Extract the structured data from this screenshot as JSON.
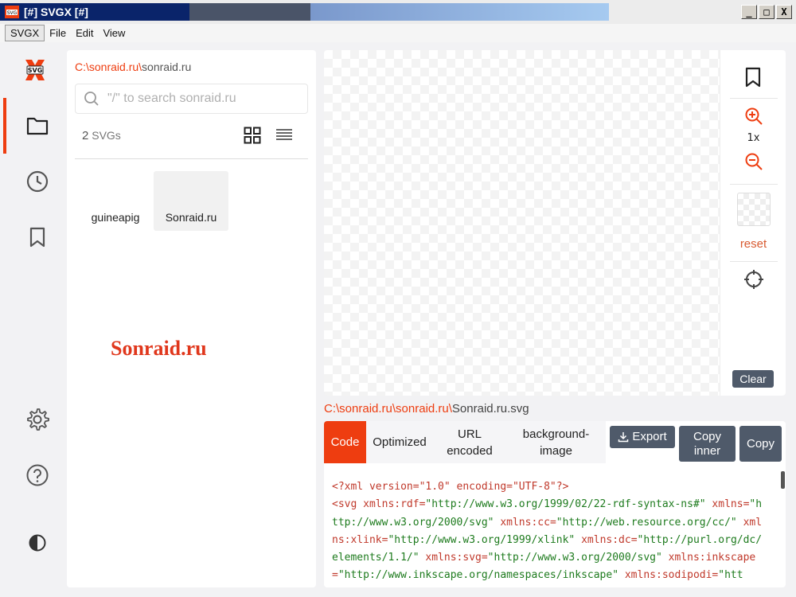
{
  "window": {
    "title": "[#] SVGX [#]",
    "icon_text": "SVG",
    "controls": [
      "_",
      "□",
      "X"
    ]
  },
  "menu": [
    "SVGX",
    "File",
    "Edit",
    "View"
  ],
  "colors": {
    "accent": "#ee3d10",
    "button": "#4f5a6a"
  },
  "rail": {
    "items": [
      {
        "name": "folder-icon",
        "active": true
      },
      {
        "name": "history-icon",
        "active": false
      },
      {
        "name": "bookmark-icon",
        "active": false
      },
      {
        "name": "settings-icon",
        "active": false
      },
      {
        "name": "help-icon",
        "active": false
      },
      {
        "name": "contrast-icon",
        "active": false
      }
    ]
  },
  "files": {
    "breadcrumb": {
      "root": "C:\\",
      "folder": "sonraid.ru",
      "sep": "\\",
      "current": "sonraid.ru"
    },
    "search_placeholder": "\"/\" to search sonraid.ru",
    "count_num": "2",
    "count_label": " SVGs",
    "items": [
      {
        "label": "guineapig",
        "selected": false
      },
      {
        "label": "Sonraid.ru",
        "selected": true
      }
    ],
    "watermark": "Sonraid.ru"
  },
  "preview": {
    "zoom": "1x",
    "reset": "reset",
    "clear": "Clear"
  },
  "file_path": {
    "root": "C:\\",
    "seg1": "sonraid.ru",
    "seg2": "sonraid.ru",
    "sep": "\\",
    "file": "Sonraid.ru.svg"
  },
  "code_panel": {
    "tabs": [
      {
        "label": "Code",
        "active": true
      },
      {
        "label": "Optimized",
        "active": false
      },
      {
        "label": "URL\nencoded",
        "active": false
      },
      {
        "label": "background-\nimage",
        "active": false
      }
    ],
    "export": "Export",
    "copy_inner": "Copy\ninner",
    "copy": "Copy",
    "lines": [
      [
        [
          "t",
          "<?xml version=\"1.0\" encoding=\"UTF-8\"?>"
        ]
      ],
      [
        [
          "t",
          "<svg xmlns:rdf="
        ],
        [
          "v",
          "\"http://www.w3.org/1999/02/22-rdf-syntax-ns#\""
        ],
        [
          "t",
          " xmlns="
        ],
        [
          "v",
          "\"h"
        ]
      ],
      [
        [
          "v",
          "ttp://www.w3.org/2000/svg\""
        ],
        [
          "t",
          " xmlns:cc="
        ],
        [
          "v",
          "\"http://web.resource.org/cc/\""
        ],
        [
          "t",
          " xml"
        ]
      ],
      [
        [
          "t",
          "ns:xlink="
        ],
        [
          "v",
          "\"http://www.w3.org/1999/xlink\""
        ],
        [
          "t",
          " xmlns:dc="
        ],
        [
          "v",
          "\"http://purl.org/dc/"
        ]
      ],
      [
        [
          "v",
          "elements/1.1/\""
        ],
        [
          "t",
          " xmlns:svg="
        ],
        [
          "v",
          "\"http://www.w3.org/2000/svg\""
        ],
        [
          "t",
          " xmlns:inkscape"
        ]
      ],
      [
        [
          "t",
          "="
        ],
        [
          "v",
          "\"http://www.inkscape.org/namespaces/inkscape\""
        ],
        [
          "t",
          " xmlns:sodipodi="
        ],
        [
          "v",
          "\"htt"
        ]
      ]
    ]
  }
}
